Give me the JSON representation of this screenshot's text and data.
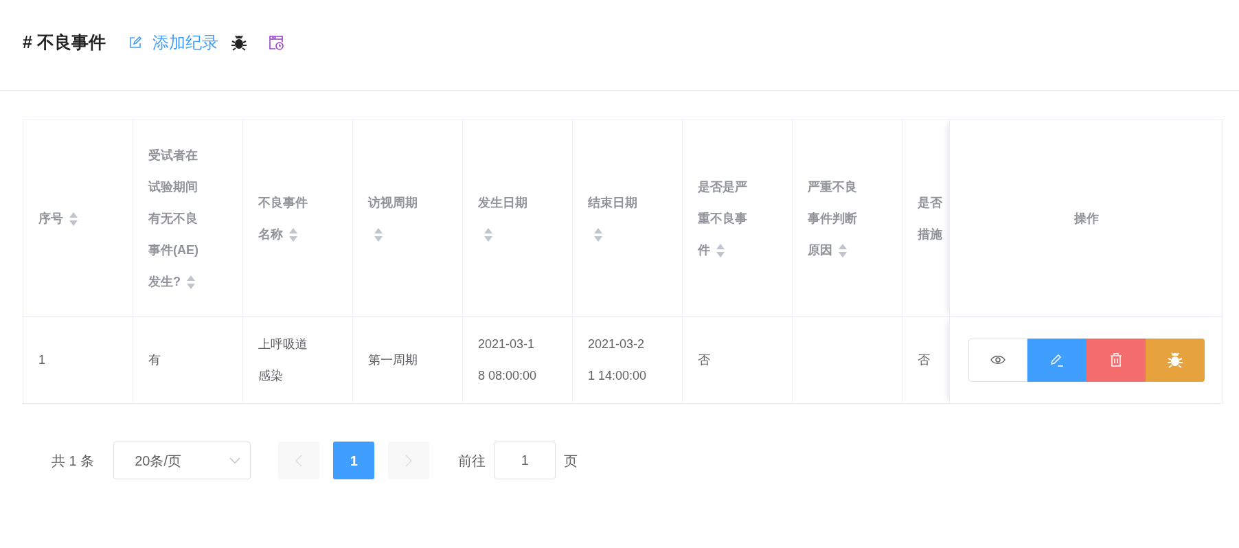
{
  "header": {
    "title": "# 不良事件",
    "add_link": "添加纪录"
  },
  "table": {
    "columns": [
      {
        "label": "序号",
        "sortable": true,
        "kind": "data"
      },
      {
        "label": "受试者在试验期间有无不良事件(AE)发生?",
        "sortable": true,
        "kind": "data"
      },
      {
        "label": "不良事件名称",
        "sortable": true,
        "kind": "data"
      },
      {
        "label": "访视周期",
        "sortable": true,
        "kind": "data"
      },
      {
        "label": "发生日期",
        "sortable": true,
        "kind": "data"
      },
      {
        "label": "结束日期",
        "sortable": true,
        "kind": "data"
      },
      {
        "label": "是否是严重不良事件",
        "sortable": true,
        "kind": "data"
      },
      {
        "label": "严重不良事件判断原因",
        "sortable": true,
        "kind": "data"
      },
      {
        "label": "是否措施",
        "sortable": false,
        "kind": "clipped"
      },
      {
        "label": "操作",
        "sortable": false,
        "kind": "actions"
      }
    ],
    "rows": [
      {
        "cells": [
          "1",
          "有",
          "上呼吸道感染",
          "第一周期",
          "2021-03-18 08:00:00",
          "2021-03-21 14:00:00",
          "否",
          null,
          "否"
        ],
        "actions": [
          {
            "kind": "view"
          },
          {
            "kind": "edit"
          },
          {
            "kind": "delete"
          },
          {
            "kind": "bug"
          }
        ]
      }
    ]
  },
  "pagination": {
    "total": "共 1 条",
    "page_size": "20条/页",
    "prev_disabled": true,
    "next_disabled": true,
    "pages": [
      {
        "label": "1",
        "selected": true
      }
    ],
    "goto_label": "前往",
    "goto_value": "1",
    "goto_suffix": "页"
  }
}
